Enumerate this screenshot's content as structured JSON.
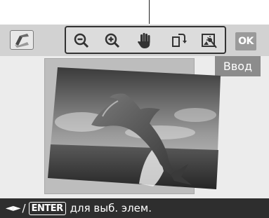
{
  "topbar": {
    "tools": [
      {
        "icon": "zoom-out-icon"
      },
      {
        "icon": "zoom-in-icon"
      },
      {
        "icon": "hand-pan-icon"
      },
      {
        "icon": "rotate-icon"
      },
      {
        "icon": "adjust-image-icon"
      }
    ],
    "ok_label": "OK",
    "enter_label": "Ввод"
  },
  "hint": {
    "arrows": "◄►",
    "slash": "/",
    "enter_key": "ENTER",
    "text": "для выб. элем."
  }
}
